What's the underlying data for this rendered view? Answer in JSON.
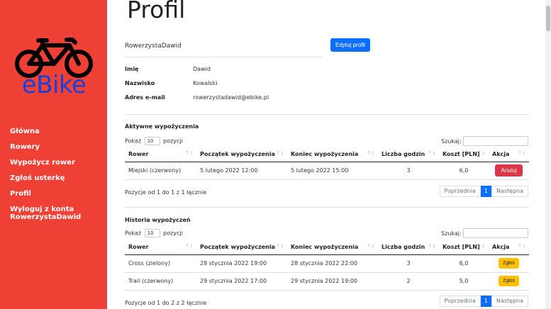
{
  "sidebar": {
    "logo_text": "eBike",
    "items": [
      {
        "label": "Główna"
      },
      {
        "label": "Rowery"
      },
      {
        "label": "Wypożycz rower"
      },
      {
        "label": "Zgłoś usterkę"
      },
      {
        "label": "Profil"
      },
      {
        "label": "Wyloguj z konta"
      },
      {
        "label": "RowerzystaDawid"
      }
    ]
  },
  "page": {
    "title": "Profil"
  },
  "profile": {
    "username": "RowerzystaDawid",
    "edit_label": "Edytuj profil",
    "fields": [
      {
        "label": "Imię",
        "value": "Dawid"
      },
      {
        "label": "Nazwisko",
        "value": "Kowalski"
      },
      {
        "label": "Adres e-mail",
        "value": "rowerzystadawid@ebike.pl"
      }
    ]
  },
  "active": {
    "title": "Aktywne wypożyczenia",
    "show_prefix": "Pokaż",
    "show_value": "10",
    "show_suffix": "pozycji",
    "search_label": "Szukaj:",
    "columns": [
      "Rower",
      "Początek wypożyczenia",
      "Koniec wypożyczenia",
      "Liczba godzin",
      "Koszt [PLN]",
      "Akcja"
    ],
    "rows": [
      {
        "bike": "Miejski (czerwony)",
        "start": "5 lutego 2022 12:00",
        "end": "5 lutego 2022 15:00",
        "hours": "3",
        "cost": "6,0",
        "action": "Anuluj"
      }
    ],
    "info": "Pozycje od 1 do 1 z 1 łącznie",
    "prev": "Poprzednia",
    "page": "1",
    "next": "Następna"
  },
  "history": {
    "title": "Historia wypożyczeń",
    "show_prefix": "Pokaż",
    "show_value": "10",
    "show_suffix": "pozycji",
    "search_label": "Szukaj:",
    "columns": [
      "Rower",
      "Początek wypożyczenia",
      "Koniec wypożyczenia",
      "Liczba godzin",
      "Koszt [PLN]",
      "Akcja"
    ],
    "rows": [
      {
        "bike": "Cross (zielony)",
        "start": "28 stycznia 2022 19:00",
        "end": "28 stycznia 2022 22:00",
        "hours": "3",
        "cost": "6,0",
        "action": "Zgłoś"
      },
      {
        "bike": "Trail (czerwony)",
        "start": "29 stycznia 2022 17:00",
        "end": "29 stycznia 2022 19:00",
        "hours": "2",
        "cost": "5,0",
        "action": "Zgłoś"
      }
    ],
    "info": "Pozycje od 1 do 2 z 2 łącznie",
    "prev": "Poprzednia",
    "page": "1",
    "next": "Następna"
  },
  "colors": {
    "sidebar": "#ef4036",
    "primary": "#0d6efd",
    "danger": "#dc3545",
    "warning": "#ffc107",
    "logo_text": "#1a3fd6"
  }
}
